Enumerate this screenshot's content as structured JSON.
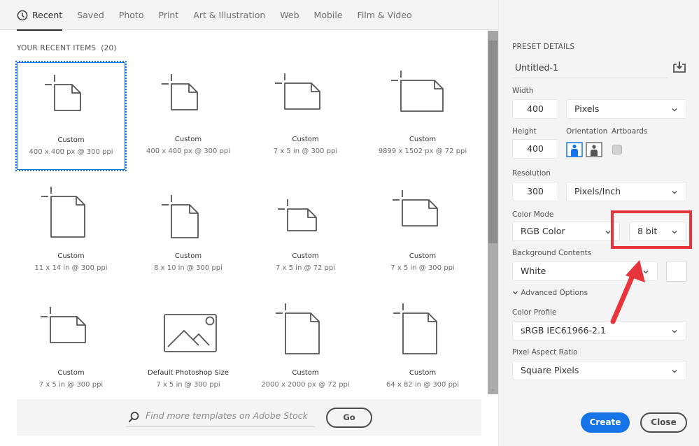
{
  "tabs": [
    {
      "label": "Recent",
      "active": true,
      "icon": "clock-icon"
    },
    {
      "label": "Saved"
    },
    {
      "label": "Photo"
    },
    {
      "label": "Print"
    },
    {
      "label": "Art & Illustration"
    },
    {
      "label": "Web"
    },
    {
      "label": "Mobile"
    },
    {
      "label": "Film & Video"
    }
  ],
  "recent": {
    "title": "YOUR RECENT ITEMS",
    "count": "(20)",
    "items": [
      {
        "name": "Custom",
        "size": "400 x 400 px @ 300 ppi",
        "shape": "square",
        "selected": true
      },
      {
        "name": "Custom",
        "size": "400 x 400 px @ 300 ppi",
        "shape": "square"
      },
      {
        "name": "Custom",
        "size": "7 x 5 in @ 300 ppi",
        "shape": "landscape"
      },
      {
        "name": "Custom",
        "size": "9899 x 1502 px @ 72 ppi",
        "shape": "wide"
      },
      {
        "name": "Custom",
        "size": "11 x 14 in @ 300 ppi",
        "shape": "portrait-tall"
      },
      {
        "name": "Custom",
        "size": "8 x 10 in @ 300 ppi",
        "shape": "portrait"
      },
      {
        "name": "Custom",
        "size": "7 x 5 in @ 72 ppi",
        "shape": "landscape-small"
      },
      {
        "name": "Custom",
        "size": "7 x 5 in @ 300 ppi",
        "shape": "landscape"
      },
      {
        "name": "Custom",
        "size": "7 x 5 in @ 300 ppi",
        "shape": "landscape"
      },
      {
        "name": "Default Photoshop Size",
        "size": "7 x 5 in @ 300 ppi",
        "shape": "photo"
      },
      {
        "name": "Custom",
        "size": "2000 x 2000 px @ 72 ppi",
        "shape": "portrait-tall"
      },
      {
        "name": "Custom",
        "size": "64 x 82 in @ 300 ppi",
        "shape": "portrait-tall"
      }
    ]
  },
  "stock": {
    "placeholder": "Find more templates on Adobe Stock",
    "go_label": "Go"
  },
  "preset": {
    "title": "PRESET DETAILS",
    "name": "Untitled-1",
    "width_label": "Width",
    "width_value": "400",
    "width_unit": "Pixels",
    "height_label": "Height",
    "height_value": "400",
    "orientation_label": "Orientation",
    "orientation": "portrait",
    "artboards_label": "Artboards",
    "artboards_checked": false,
    "resolution_label": "Resolution",
    "resolution_value": "300",
    "resolution_unit": "Pixels/Inch",
    "color_mode_label": "Color Mode",
    "color_mode": "RGB Color",
    "bit_depth": "8 bit",
    "background_label": "Background Contents",
    "background": "White",
    "background_swatch": "#ffffff",
    "advanced_label": "Advanced Options",
    "color_profile_label": "Color Profile",
    "color_profile": "sRGB IEC61966-2.1",
    "pixel_aspect_label": "Pixel Aspect Ratio",
    "pixel_aspect": "Square Pixels"
  },
  "actions": {
    "create_label": "Create",
    "close_label": "Close"
  },
  "colors": {
    "accent": "#1473e6",
    "annotation": "#e8353c"
  }
}
